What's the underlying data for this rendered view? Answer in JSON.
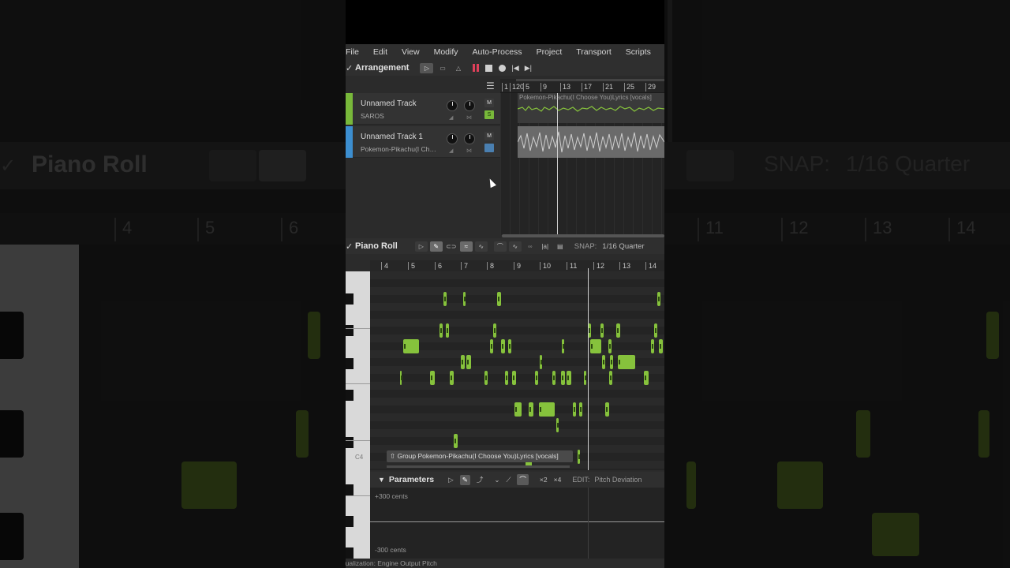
{
  "menu": [
    "File",
    "Edit",
    "View",
    "Modify",
    "Auto-Process",
    "Project",
    "Transport",
    "Scripts"
  ],
  "arrangement": {
    "title": "Arrangement",
    "ruler": [
      "1",
      "120",
      "5",
      "9",
      "13",
      "17",
      "21",
      "25",
      "29"
    ]
  },
  "tracks": [
    {
      "name": "Unnamed Track",
      "sub": "SAROS",
      "color": "#78b83a",
      "mute": "M",
      "solo": "S"
    },
    {
      "name": "Unnamed Track 1",
      "sub": "Pokemon-Pikachu(I Choose You)",
      "color": "#3c8ed0",
      "mute": "M"
    }
  ],
  "clip1_label": "Pokemon-Pikachu(I Choose You)Lyrics [vocals]",
  "piano_roll": {
    "title": "Piano Roll",
    "snap_label": "SNAP:",
    "snap_value": "1/16 Quarter",
    "ruler": [
      "4",
      "5",
      "6",
      "7",
      "8",
      "9",
      "10",
      "11",
      "12",
      "13",
      "14"
    ],
    "c4_label": "C4",
    "group_label": "Group Pokemon-Pikachu(I Choose You)Lyrics [vocals]"
  },
  "parameters": {
    "title": "Parameters",
    "edit_label": "EDIT:",
    "edit_value": "Pitch Deviation",
    "top_label": "+300 cents",
    "bottom_label": "-300 cents",
    "btn_x2": "×2",
    "btn_x4": "×4"
  },
  "status": "Visualization: Engine Output Pitch",
  "colors": {
    "note": "#86c23c",
    "record": "#e0405a",
    "solo": "#78b83a"
  }
}
